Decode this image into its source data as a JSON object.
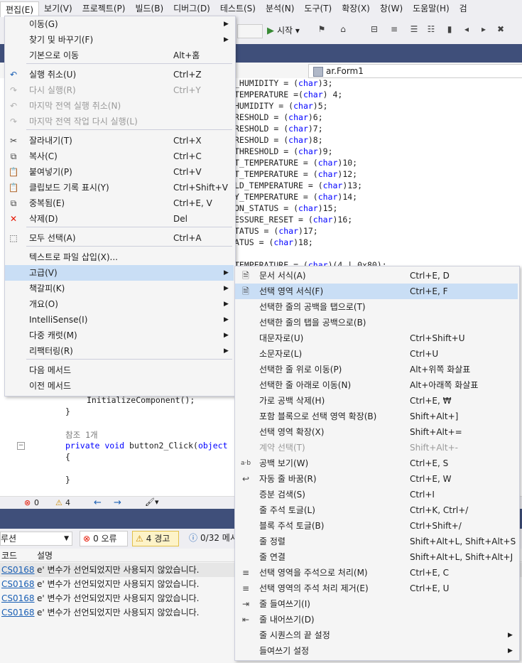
{
  "menubar": {
    "items": [
      "편집(E)",
      "보기(V)",
      "프로젝트(P)",
      "빌드(B)",
      "디버그(D)",
      "테스트(S)",
      "분석(N)",
      "도구(T)",
      "확장(X)",
      "창(W)",
      "도움말(H)",
      "검"
    ]
  },
  "toolbar": {
    "start_label": "시작"
  },
  "nav": {
    "class_label": "ar.Form1"
  },
  "code_lines": [
    "_HUMIDITY = (char)3;",
    "TEMPERATURE =(char) 4;",
    "HUMIDITY = (char)5;",
    "RESHOLD = (char)6;",
    "RESHOLD = (char)7;",
    "RESHOLD = (char)8;",
    "THRESHOLD = (char)9;",
    "T_TEMPERATURE = (char)10;",
    "T_TEMPERATURE = (char)12;",
    "LD_TEMPERATURE = (char)13;",
    "Y_TEMPERATURE = (char)14;",
    "ON_STATUS = (char)15;",
    "ESSURE_RESET = (char)16;",
    "TATUS = (char)17;",
    "ATUS = (char)18;",
    "",
    "TEMPERATURE = (char)(4 | 0x80);"
  ],
  "code_lower": {
    "init": "InitializeComponent();",
    "brace_close": "}",
    "ref": "참조 1개",
    "method": "private void button2_Click(object",
    "brace_open": "{",
    "brace_close2": "}"
  },
  "editor_status": {
    "errors": "0",
    "warnings": "4"
  },
  "error_toolbar": {
    "scope": "루션",
    "errors": "0 오류",
    "warnings": "4 경고",
    "messages": "0/32 메시"
  },
  "error_header": {
    "code": "코드",
    "desc": "설명"
  },
  "error_rows": [
    {
      "code": "CS0168",
      "desc": "e' 변수가 선언되었지만 사용되지 않았습니다."
    },
    {
      "code": "CS0168",
      "desc": "e' 변수가 선언되었지만 사용되지 않았습니다."
    },
    {
      "code": "CS0168",
      "desc": "e' 변수가 선언되었지만 사용되지 않았습니다."
    },
    {
      "code": "CS0168",
      "desc": "e' 변수가 선언되었지만 사용되지 않았습니다."
    }
  ],
  "edit_menu": [
    {
      "label": "이동(G)",
      "shortcut": "",
      "submenu": true,
      "icon": "",
      "disabled": false
    },
    {
      "label": "찾기 및 바꾸기(F)",
      "shortcut": "",
      "submenu": true,
      "icon": "",
      "disabled": false
    },
    {
      "label": "기본으로 이동",
      "shortcut": "Alt+홈",
      "submenu": false,
      "icon": "",
      "disabled": false
    },
    {
      "label": "실행 취소(U)",
      "shortcut": "Ctrl+Z",
      "submenu": false,
      "icon": "undo-icon",
      "disabled": false
    },
    {
      "label": "다시 실행(R)",
      "shortcut": "Ctrl+Y",
      "submenu": false,
      "icon": "redo-icon",
      "disabled": true
    },
    {
      "label": "마지막 전역 실행 취소(N)",
      "shortcut": "",
      "submenu": false,
      "icon": "global-undo-icon",
      "disabled": true
    },
    {
      "label": "마지막 전역 작업 다시 실행(L)",
      "shortcut": "",
      "submenu": false,
      "icon": "global-redo-icon",
      "disabled": true
    },
    {
      "label": "잘라내기(T)",
      "shortcut": "Ctrl+X",
      "submenu": false,
      "icon": "cut-icon",
      "disabled": false
    },
    {
      "label": "복사(C)",
      "shortcut": "Ctrl+C",
      "submenu": false,
      "icon": "copy-icon",
      "disabled": false
    },
    {
      "label": "붙여넣기(P)",
      "shortcut": "Ctrl+V",
      "submenu": false,
      "icon": "paste-icon",
      "disabled": false
    },
    {
      "label": "클립보드 기록 표시(Y)",
      "shortcut": "Ctrl+Shift+V",
      "submenu": false,
      "icon": "clipboard-history-icon",
      "disabled": false
    },
    {
      "label": "중복됨(E)",
      "shortcut": "Ctrl+E, V",
      "submenu": false,
      "icon": "duplicate-icon",
      "disabled": false
    },
    {
      "label": "삭제(D)",
      "shortcut": "Del",
      "submenu": false,
      "icon": "delete-icon",
      "disabled": false
    },
    {
      "label": "모두 선택(A)",
      "shortcut": "Ctrl+A",
      "submenu": false,
      "icon": "select-all-icon",
      "disabled": false
    },
    {
      "label": "텍스트로 파일 삽입(X)...",
      "shortcut": "",
      "submenu": false,
      "icon": "",
      "disabled": false
    },
    {
      "label": "고급(V)",
      "shortcut": "",
      "submenu": true,
      "icon": "",
      "disabled": false
    },
    {
      "label": "책갈피(K)",
      "shortcut": "",
      "submenu": true,
      "icon": "",
      "disabled": false
    },
    {
      "label": "개요(O)",
      "shortcut": "",
      "submenu": true,
      "icon": "",
      "disabled": false
    },
    {
      "label": "IntelliSense(I)",
      "shortcut": "",
      "submenu": true,
      "icon": "",
      "disabled": false
    },
    {
      "label": "다중 캐럿(M)",
      "shortcut": "",
      "submenu": true,
      "icon": "",
      "disabled": false
    },
    {
      "label": "리팩터링(R)",
      "shortcut": "",
      "submenu": true,
      "icon": "",
      "disabled": false
    },
    {
      "label": "다음 메서드",
      "shortcut": "",
      "submenu": false,
      "icon": "",
      "disabled": false
    },
    {
      "label": "이전 메서드",
      "shortcut": "",
      "submenu": false,
      "icon": "",
      "disabled": false
    }
  ],
  "advanced_menu": [
    {
      "label": "문서 서식(A)",
      "shortcut": "Ctrl+E, D",
      "submenu": false,
      "icon": "format-document-icon",
      "disabled": false
    },
    {
      "label": "선택 영역 서식(F)",
      "shortcut": "Ctrl+E, F",
      "submenu": false,
      "icon": "format-selection-icon",
      "disabled": false
    },
    {
      "label": "선택한 줄의 공백을 탭으로(T)",
      "shortcut": "",
      "submenu": false,
      "icon": "",
      "disabled": false
    },
    {
      "label": "선택한 줄의 탭을 공백으로(B)",
      "shortcut": "",
      "submenu": false,
      "icon": "",
      "disabled": false
    },
    {
      "label": "대문자로(U)",
      "shortcut": "Ctrl+Shift+U",
      "submenu": false,
      "icon": "",
      "disabled": false
    },
    {
      "label": "소문자로(L)",
      "shortcut": "Ctrl+U",
      "submenu": false,
      "icon": "",
      "disabled": false
    },
    {
      "label": "선택한 줄 위로 이동(P)",
      "shortcut": "Alt+위쪽 화살표",
      "submenu": false,
      "icon": "",
      "disabled": false
    },
    {
      "label": "선택한 줄 아래로 이동(N)",
      "shortcut": "Alt+아래쪽 화살표",
      "submenu": false,
      "icon": "",
      "disabled": false
    },
    {
      "label": "가로 공백 삭제(H)",
      "shortcut": "Ctrl+E, ₩",
      "submenu": false,
      "icon": "",
      "disabled": false
    },
    {
      "label": "포함 블록으로 선택 영역 확장(B)",
      "shortcut": "Shift+Alt+]",
      "submenu": false,
      "icon": "",
      "disabled": false
    },
    {
      "label": "선택 영역 확장(X)",
      "shortcut": "Shift+Alt+=",
      "submenu": false,
      "icon": "",
      "disabled": false
    },
    {
      "label": "계약 선택(T)",
      "shortcut": "Shift+Alt+-",
      "submenu": false,
      "icon": "",
      "disabled": true
    },
    {
      "label": "공백 보기(W)",
      "shortcut": "Ctrl+E, S",
      "submenu": false,
      "icon": "whitespace-icon",
      "disabled": false
    },
    {
      "label": "자동 줄 바꿈(R)",
      "shortcut": "Ctrl+E, W",
      "submenu": false,
      "icon": "word-wrap-icon",
      "disabled": false
    },
    {
      "label": "증분 검색(S)",
      "shortcut": "Ctrl+I",
      "submenu": false,
      "icon": "",
      "disabled": false
    },
    {
      "label": "줄 주석 토글(L)",
      "shortcut": "Ctrl+K, Ctrl+/",
      "submenu": false,
      "icon": "",
      "disabled": false
    },
    {
      "label": "블록 주석 토글(B)",
      "shortcut": "Ctrl+Shift+/",
      "submenu": false,
      "icon": "",
      "disabled": false
    },
    {
      "label": "줄 정렬",
      "shortcut": "Shift+Alt+L, Shift+Alt+S",
      "submenu": false,
      "icon": "",
      "disabled": false
    },
    {
      "label": "줄 연결",
      "shortcut": "Shift+Alt+L, Shift+Alt+J",
      "submenu": false,
      "icon": "",
      "disabled": false
    },
    {
      "label": "선택 영역을 주석으로 처리(M)",
      "shortcut": "Ctrl+E, C",
      "submenu": false,
      "icon": "comment-icon",
      "disabled": false
    },
    {
      "label": "선택 영역의 주석 처리 제거(E)",
      "shortcut": "Ctrl+E, U",
      "submenu": false,
      "icon": "uncomment-icon",
      "disabled": false
    },
    {
      "label": "줄 들여쓰기(I)",
      "shortcut": "",
      "submenu": false,
      "icon": "indent-icon",
      "disabled": false
    },
    {
      "label": "줄 내어쓰기(D)",
      "shortcut": "",
      "submenu": false,
      "icon": "outdent-icon",
      "disabled": false
    },
    {
      "label": "줄 시퀀스의 끝 설정",
      "shortcut": "",
      "submenu": true,
      "icon": "",
      "disabled": false
    },
    {
      "label": "들여쓰기 설정",
      "shortcut": "",
      "submenu": true,
      "icon": "",
      "disabled": false
    }
  ]
}
